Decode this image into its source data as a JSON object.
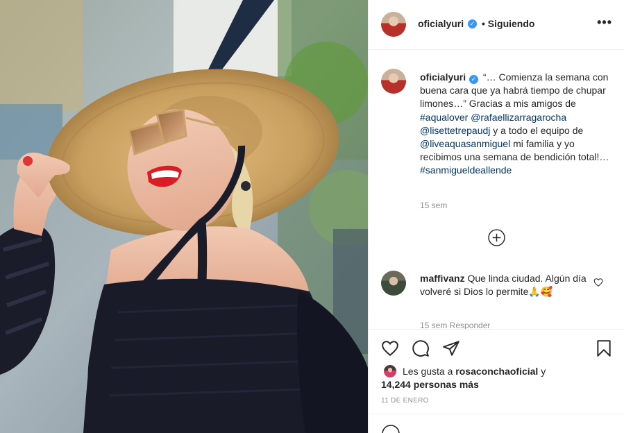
{
  "post": {
    "username": "oficialyuri",
    "verified_glyph": "✓",
    "follow_separator": "•",
    "follow_status": "Siguiendo",
    "more_glyph": "•••",
    "caption_parts": [
      {
        "type": "text",
        "value": "“… Comienza la semana con buena cara que ya habrá tiempo de chupar limones…” Gracias a mis amigos de "
      },
      {
        "type": "link",
        "value": "#aqualover"
      },
      {
        "type": "text",
        "value": " "
      },
      {
        "type": "link",
        "value": "@rafaellizarragarocha"
      },
      {
        "type": "text",
        "value": " "
      },
      {
        "type": "link",
        "value": "@lisettetrepaudj"
      },
      {
        "type": "text",
        "value": " y a todo el equipo de "
      },
      {
        "type": "link",
        "value": "@liveaquasanmiguel"
      },
      {
        "type": "text",
        "value": " mi familia y yo recibimos una semana de bendición total!… "
      },
      {
        "type": "link",
        "value": "#sanmigueldeallende"
      }
    ],
    "caption_time": "15 sem",
    "comment": {
      "username": "maffivanz",
      "text": "Que linda ciudad. Algún día volveré si Dios lo permite🙏🥰",
      "meta": "15 sem   Responder"
    },
    "likes": {
      "prefix": "Les gusta a ",
      "user": "rosaconchaoficial",
      "middle": " y ",
      "count": "14,244 personas más"
    },
    "date": "11 DE ENERO"
  },
  "icons": {
    "like": "heart-icon",
    "comment": "comment-icon",
    "share": "paper-plane-icon",
    "save": "bookmark-icon",
    "load_more": "plus-circle-icon",
    "comment_like": "heart-small-icon"
  },
  "colors": {
    "link": "#00376b",
    "verified": "#3897f0",
    "muted": "#8e8e8e",
    "lipstick": "#d81d25",
    "hat": "#c9a266"
  }
}
